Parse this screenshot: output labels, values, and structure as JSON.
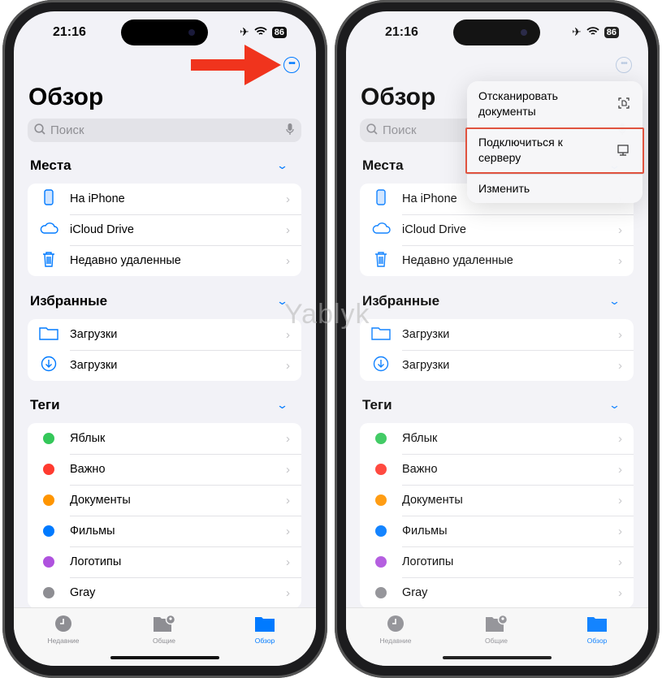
{
  "status": {
    "time": "21:16",
    "battery": "86"
  },
  "page_title": "Обзор",
  "search": {
    "placeholder": "Поиск"
  },
  "sections": [
    {
      "title": "Места",
      "items": [
        {
          "label": "На iPhone",
          "icon": "phone-icon"
        },
        {
          "label": "iCloud Drive",
          "icon": "cloud-icon"
        },
        {
          "label": "Недавно удаленные",
          "icon": "trash-icon"
        }
      ]
    },
    {
      "title": "Избранные",
      "items": [
        {
          "label": "Загрузки",
          "icon": "folder-icon"
        },
        {
          "label": "Загрузки",
          "icon": "download-icon"
        }
      ]
    },
    {
      "title": "Теги",
      "items": [
        {
          "label": "Яблык",
          "color": "#34c759"
        },
        {
          "label": "Важно",
          "color": "#ff3b30"
        },
        {
          "label": "Документы",
          "color": "#ff9500"
        },
        {
          "label": "Фильмы",
          "color": "#007aff"
        },
        {
          "label": "Логотипы",
          "color": "#af52de"
        },
        {
          "label": "Gray",
          "color": "#8e8e93"
        }
      ]
    }
  ],
  "tabs": [
    {
      "label": "Недавние",
      "icon": "clock-icon",
      "active": false
    },
    {
      "label": "Общие",
      "icon": "shared-folder-icon",
      "active": false
    },
    {
      "label": "Обзор",
      "icon": "folder-icon",
      "active": true
    }
  ],
  "menu": {
    "items": [
      {
        "label": "Отсканировать документы",
        "icon": "scan-document-icon"
      },
      {
        "label": "Подключиться к серверу",
        "icon": "server-icon",
        "highlighted": true
      },
      {
        "label": "Изменить"
      }
    ]
  },
  "watermark": "Yablyk",
  "colors": {
    "accent": "#007aff",
    "highlight": "#e0533f",
    "arrow": "#f0341d"
  }
}
